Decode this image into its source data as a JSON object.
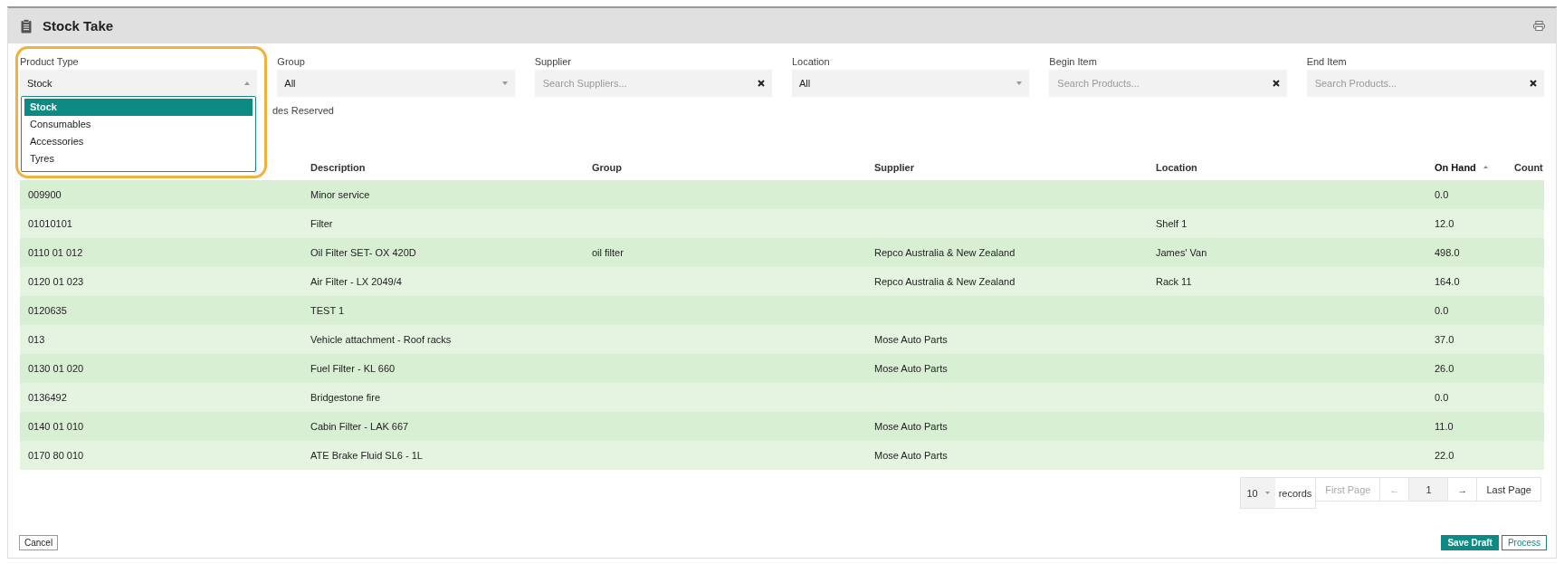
{
  "title": "Stock Take",
  "filters": [
    {
      "label": "Product Type",
      "kind": "select",
      "value": "Stock",
      "open": true
    },
    {
      "label": "Group",
      "kind": "select",
      "value": "All",
      "open": false
    },
    {
      "label": "Supplier",
      "kind": "search",
      "placeholder": "Search Suppliers..."
    },
    {
      "label": "Location",
      "kind": "select",
      "value": "All",
      "open": false
    },
    {
      "label": "Begin Item",
      "kind": "search",
      "placeholder": "Search Products..."
    },
    {
      "label": "End Item",
      "kind": "search",
      "placeholder": "Search Products..."
    }
  ],
  "dropdown_options": [
    {
      "label": "Stock",
      "selected": true
    },
    {
      "label": "Consumables",
      "selected": false
    },
    {
      "label": "Accessories",
      "selected": false
    },
    {
      "label": "Tyres",
      "selected": false
    }
  ],
  "hidden_option_text": "des Reserved",
  "table": {
    "columns": [
      {
        "sorted": false
      },
      {
        "label": "Description",
        "sorted": false
      },
      {
        "label": "Group",
        "sorted": false
      },
      {
        "label": "Supplier",
        "sorted": false
      },
      {
        "label": "Location",
        "sorted": false
      },
      {
        "label": "On Hand",
        "sorted": true
      },
      {
        "label": "Count",
        "sorted": false
      }
    ],
    "rows": [
      [
        "009900",
        "Minor service",
        "",
        "",
        "",
        "0.0",
        ""
      ],
      [
        "01010101",
        "Filter",
        "",
        "",
        "Shelf 1",
        "12.0",
        ""
      ],
      [
        "0110 01 012",
        "Oil Filter SET- OX 420D",
        "oil filter",
        "Repco Australia & New Zealand",
        "James' Van",
        "498.0",
        ""
      ],
      [
        "0120 01 023",
        "Air Filter - LX 2049/4",
        "",
        "Repco Australia & New Zealand",
        "Rack 11",
        "164.0",
        ""
      ],
      [
        "0120635",
        "TEST 1",
        "",
        "",
        "",
        "0.0",
        ""
      ],
      [
        "013",
        "Vehicle attachment - Roof racks",
        "",
        "Mose Auto Parts",
        "",
        "37.0",
        ""
      ],
      [
        "0130 01 020",
        "Fuel Filter - KL 660",
        "",
        "Mose Auto Parts",
        "",
        "26.0",
        ""
      ],
      [
        "0136492",
        "Bridgestone fire",
        "",
        "",
        "",
        "0.0",
        ""
      ],
      [
        "0140 01 010",
        "Cabin Filter - LAK 667",
        "",
        "Mose Auto Parts",
        "",
        "11.0",
        ""
      ],
      [
        "0170 80 010",
        "ATE Brake Fluid SL6 - 1L",
        "",
        "Mose Auto Parts",
        "",
        "22.0",
        ""
      ]
    ]
  },
  "pagination": {
    "page_size": "10",
    "records_label": "records",
    "first": "First Page",
    "prev": "←",
    "page": "1",
    "next": "→",
    "last": "Last Page"
  },
  "buttons": {
    "cancel": "Cancel",
    "save_draft": "Save Draft",
    "process": "Process"
  }
}
